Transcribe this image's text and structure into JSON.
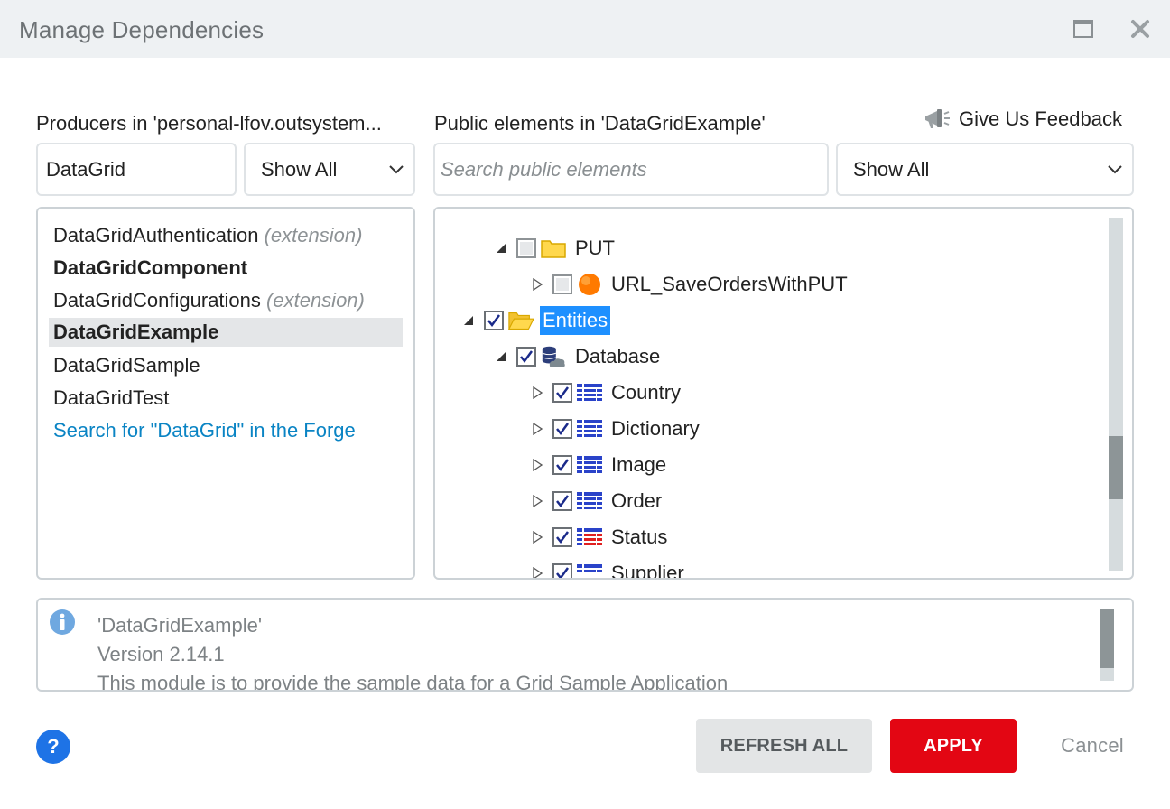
{
  "window": {
    "title": "Manage Dependencies"
  },
  "producers": {
    "label": "Producers in 'personal-lfov.outsystem...",
    "search_value": "DataGrid",
    "filter_value": "Show All",
    "items": [
      {
        "name": "DataGridAuthentication",
        "tag": "(extension)"
      },
      {
        "name": "DataGridComponent",
        "tag": ""
      },
      {
        "name": "DataGridConfigurations",
        "tag": "(extension)"
      },
      {
        "name": "DataGridExample",
        "tag": ""
      },
      {
        "name": "DataGridSample",
        "tag": ""
      },
      {
        "name": "DataGridTest",
        "tag": ""
      }
    ],
    "forge_link": "Search for \"DataGrid\" in the Forge"
  },
  "public_elements": {
    "label": "Public elements in 'DataGridExample'",
    "search_placeholder": "Search public elements",
    "filter_value": "Show All",
    "feedback_label": "Give Us Feedback",
    "tree": [
      {
        "label": "PUT",
        "icon": "folder-icon",
        "checked": false,
        "expanded": true
      },
      {
        "label": "URL_SaveOrdersWithPUT",
        "icon": "rest-method-icon",
        "checked": false,
        "expanded": false
      },
      {
        "label": "Entities",
        "icon": "folder-open-icon",
        "checked": true,
        "expanded": true,
        "selected": true
      },
      {
        "label": "Database",
        "icon": "database-icon",
        "checked": true,
        "expanded": true
      },
      {
        "label": "Country",
        "icon": "entity-icon",
        "checked": true,
        "expanded": false
      },
      {
        "label": "Dictionary",
        "icon": "entity-icon",
        "checked": true,
        "expanded": false
      },
      {
        "label": "Image",
        "icon": "entity-icon",
        "checked": true,
        "expanded": false
      },
      {
        "label": "Order",
        "icon": "entity-icon",
        "checked": true,
        "expanded": false
      },
      {
        "label": "Status",
        "icon": "static-entity-icon",
        "checked": true,
        "expanded": false
      },
      {
        "label": "Supplier",
        "icon": "entity-icon",
        "checked": true,
        "expanded": false
      }
    ]
  },
  "info": {
    "module_name": "'DataGridExample'",
    "version": "Version 2.14.1",
    "description": "This module is to provide the sample data for a Grid Sample Application"
  },
  "footer": {
    "help_label": "?",
    "refresh_label": "REFRESH ALL",
    "apply_label": "APPLY",
    "cancel_label": "Cancel"
  },
  "colors": {
    "accent_blue": "#1e90ff",
    "apply_red": "#e30613",
    "link_blue": "#0a84c4"
  }
}
